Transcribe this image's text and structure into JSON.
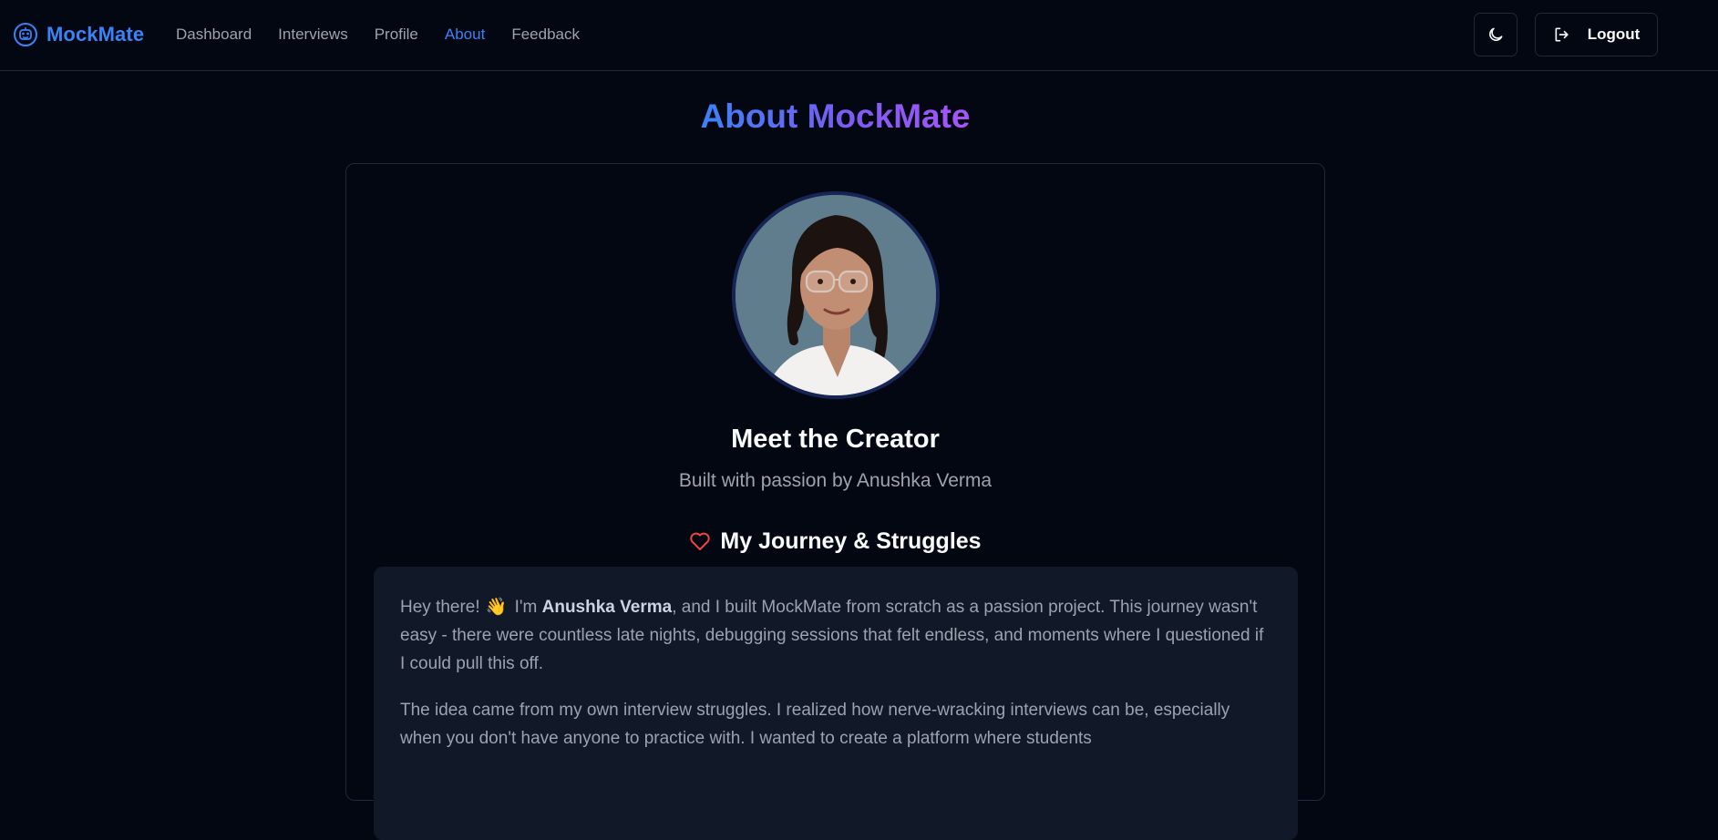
{
  "app": {
    "name": "MockMate"
  },
  "nav": {
    "links": [
      {
        "label": "Dashboard",
        "active": false
      },
      {
        "label": "Interviews",
        "active": false
      },
      {
        "label": "Profile",
        "active": false
      },
      {
        "label": "About",
        "active": true
      },
      {
        "label": "Feedback",
        "active": false
      }
    ],
    "theme_icon": "moon-icon",
    "logout_label": "Logout",
    "logout_icon": "logout-icon"
  },
  "page": {
    "title": "About MockMate"
  },
  "creator": {
    "heading": "Meet the Creator",
    "subtitle": "Built with passion by Anushka Verma",
    "avatar_icon": "creator-photo"
  },
  "journey": {
    "heading": "My Journey & Struggles",
    "heading_icon": "heart-icon",
    "para1": {
      "greeting": "Hey there!",
      "emoji": "👋",
      "pre": "I'm",
      "name": "Anushka Verma",
      "rest": ", and I built MockMate from scratch as a passion project. This journey wasn't easy - there were countless late nights, debugging sessions that felt endless, and moments where I questioned if I could pull this off."
    },
    "para2": "The idea came from my own interview struggles. I realized how nerve-wracking interviews can be, especially when you don't have anyone to practice with. I wanted to create a platform where students"
  },
  "colors": {
    "background": "#030712",
    "accent": "#3b82f6",
    "gradient_end": "#a855f7",
    "heart": "#ef4444",
    "muted_text": "#9ca3af"
  }
}
